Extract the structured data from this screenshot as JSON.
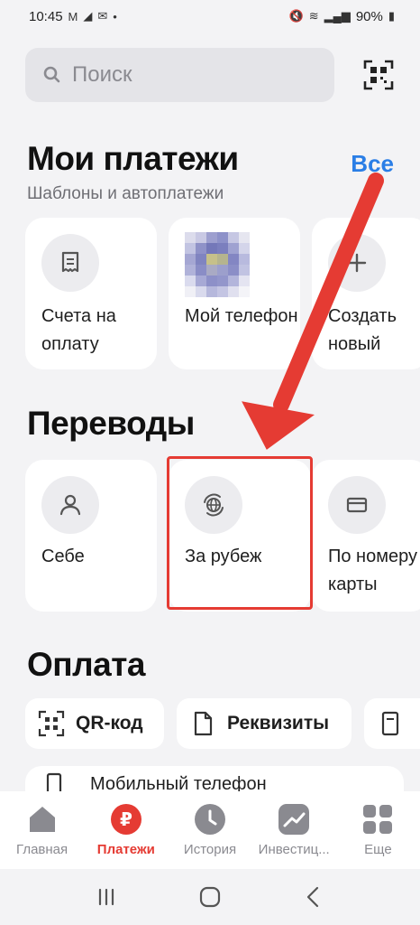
{
  "status_bar": {
    "time": "10:45",
    "battery": "90%"
  },
  "search": {
    "placeholder": "Поиск"
  },
  "my_payments": {
    "title": "Мои платежи",
    "subtitle": "Шаблоны и автоплатежи",
    "all_label": "Все",
    "cards": [
      {
        "label": "Счета на оплату",
        "icon": "invoice-icon"
      },
      {
        "label": "Мой телефон",
        "icon": "pixelated-avatar"
      },
      {
        "label": "Создать новый",
        "icon": "plus-icon"
      }
    ]
  },
  "transfers": {
    "title": "Переводы",
    "cards": [
      {
        "label": "Себе",
        "icon": "person-icon"
      },
      {
        "label": "За рубеж",
        "icon": "globe-icon"
      },
      {
        "label": "По номеру карты",
        "icon": "card-icon"
      }
    ]
  },
  "payment": {
    "title": "Оплата",
    "chips": [
      {
        "label": "QR-код",
        "icon": "qr-icon"
      },
      {
        "label": "Реквизиты",
        "icon": "document-icon"
      },
      {
        "label": "",
        "icon": "receipt-icon"
      }
    ],
    "list_item": {
      "label": "Мобильный телефон",
      "icon": "phone-icon"
    }
  },
  "bottom_nav": [
    {
      "label": "Главная",
      "icon": "home-icon",
      "active": false
    },
    {
      "label": "Платежи",
      "icon": "ruble-icon",
      "active": true
    },
    {
      "label": "История",
      "icon": "clock-icon",
      "active": false
    },
    {
      "label": "Инвестиц...",
      "icon": "chart-icon",
      "active": false
    },
    {
      "label": "Еще",
      "icon": "grid-icon",
      "active": false
    }
  ],
  "colors": {
    "accent": "#e53b33",
    "link": "#2a7ee6",
    "background": "#f3f3f5"
  }
}
